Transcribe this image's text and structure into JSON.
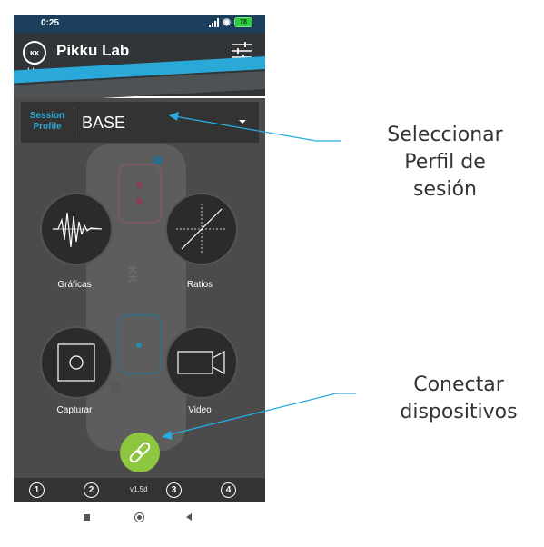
{
  "status_bar": {
    "time": "0:25",
    "battery": "78"
  },
  "header": {
    "logo_text": "ĸĸ",
    "title": "Pikku Lab",
    "breadcrumb": "Home"
  },
  "session_profile": {
    "label_line1": "Session",
    "label_line2": "Profile",
    "value": "BASE"
  },
  "actions": [
    {
      "label": "Gráficas",
      "icon": "waveform-icon"
    },
    {
      "label": "Ratios",
      "icon": "crosshair-chart-icon"
    },
    {
      "label": "Capturar",
      "icon": "capture-icon"
    },
    {
      "label": "Video",
      "icon": "video-camera-icon"
    }
  ],
  "connect_button": {
    "icon": "link-icon"
  },
  "bottom_bar": {
    "slots": [
      "1",
      "2",
      "3",
      "4"
    ],
    "version": "v1.5d"
  },
  "annotations": {
    "profile_note_lines": [
      "Seleccionar",
      "Perfil de",
      "sesión"
    ],
    "connect_note_lines": [
      "Conectar",
      "dispositivos"
    ]
  },
  "colors": {
    "accent": "#2aa9d8",
    "connect": "#8dc63f",
    "header": "#313537",
    "status": "#1c3f5e"
  }
}
